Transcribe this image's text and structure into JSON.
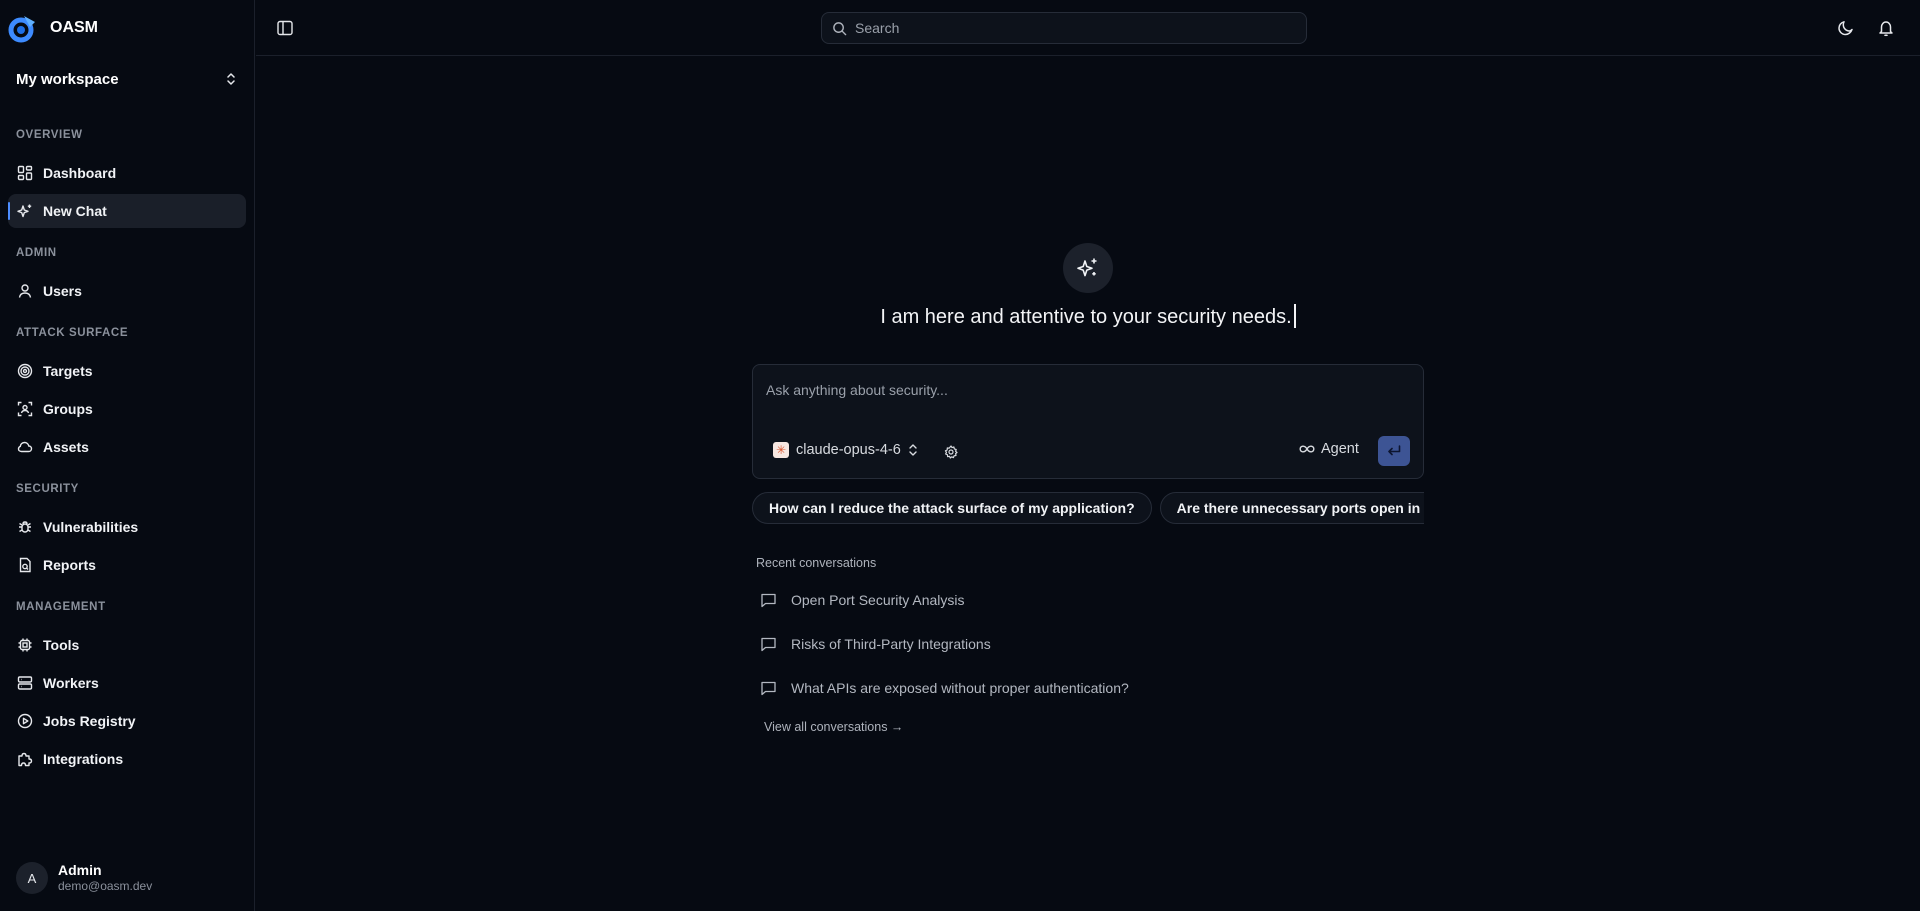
{
  "brand": {
    "name": "OASM"
  },
  "workspace": {
    "name": "My workspace"
  },
  "sidebar": {
    "sections": {
      "overview": "OVERVIEW",
      "admin": "ADMIN",
      "attack_surface": "ATTACK SURFACE",
      "security": "SECURITY",
      "management": "MANAGEMENT"
    },
    "items": {
      "dashboard": "Dashboard",
      "new_chat": "New Chat",
      "users": "Users",
      "targets": "Targets",
      "groups": "Groups",
      "assets": "Assets",
      "vulnerabilities": "Vulnerabilities",
      "reports": "Reports",
      "tools": "Tools",
      "workers": "Workers",
      "jobs_registry": "Jobs Registry",
      "integrations": "Integrations"
    },
    "active_item": "new_chat",
    "accent_color": "#4d8dff"
  },
  "user": {
    "initial": "A",
    "name": "Admin",
    "email": "demo@oasm.dev"
  },
  "header": {
    "search_placeholder": "Search",
    "icons": [
      "sidebar-toggle-icon",
      "search-icon",
      "moon-icon",
      "bell-icon"
    ]
  },
  "main": {
    "hero_text": "I am here and attentive to your security needs.",
    "composer": {
      "placeholder": "Ask anything about security...",
      "model": "claude-opus-4-6",
      "mode": "Agent",
      "send_color": "#3d5494"
    },
    "suggestions": [
      "How can I reduce the attack surface of my application?",
      "Are there unnecessary ports open in my"
    ],
    "recent": {
      "title": "Recent conversations",
      "items": [
        "Open Port Security Analysis",
        "Risks of Third-Party Integrations",
        "What APIs are exposed without proper authentication?"
      ],
      "view_all": "View all conversations →"
    }
  }
}
